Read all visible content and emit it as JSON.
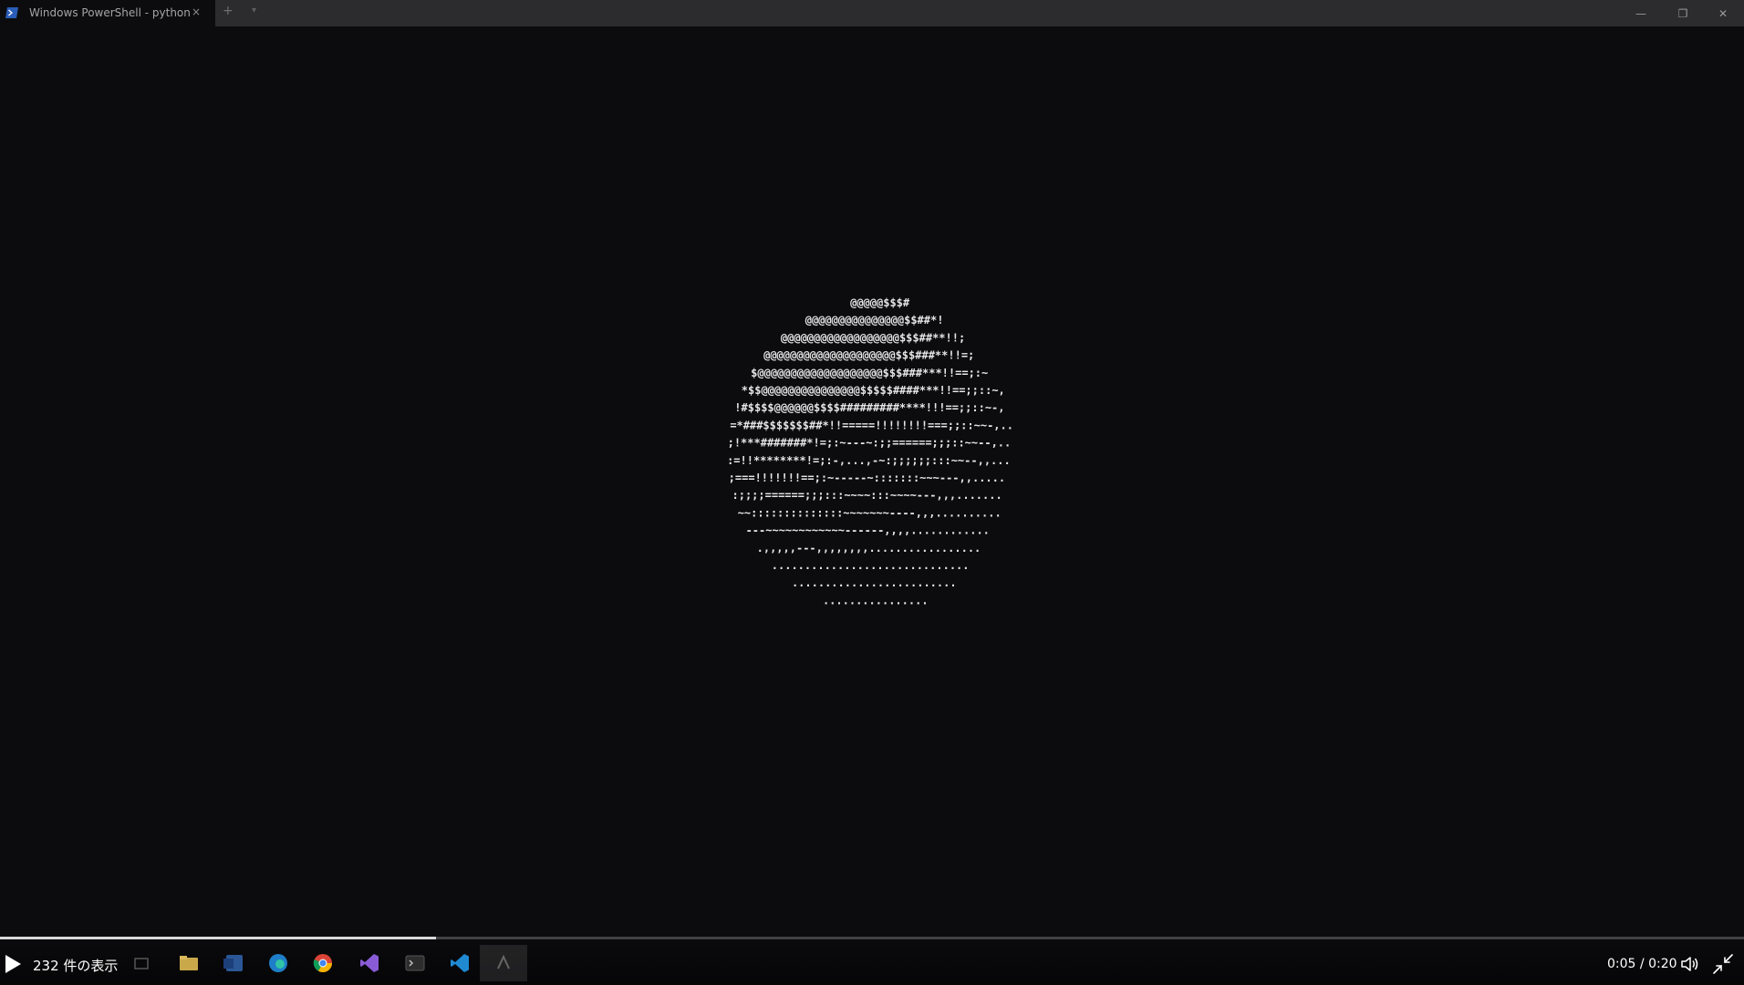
{
  "terminal": {
    "tab_title": "Windows PowerShell - python",
    "tab_close_glyph": "×",
    "new_tab_glyph": "+",
    "dropdown_glyph": "▾",
    "minimize_glyph": "—",
    "maximize_glyph": "❐",
    "close_glyph": "✕"
  },
  "player": {
    "caption": "232 件の表示",
    "current_time": "0:05",
    "duration": "0:20",
    "time_separator": " / ",
    "progress_fraction": 0.25,
    "play_icon": "play-icon",
    "volume_icon": "volume-icon",
    "exit_fullscreen_icon": "exit-fullscreen-icon"
  },
  "taskbar": {
    "icons": [
      "task-view-icon",
      "file-explorer-icon",
      "word-icon",
      "edge-icon",
      "chrome-icon",
      "visual-studio-icon",
      "terminal-icon",
      "vscode-icon",
      "python-app-icon"
    ]
  },
  "colors": {
    "background": "#0c0c0f",
    "titlebar": "#2c2c2e",
    "ascii_text": "#e6e6e6",
    "progress": "#d9d9d9"
  }
}
